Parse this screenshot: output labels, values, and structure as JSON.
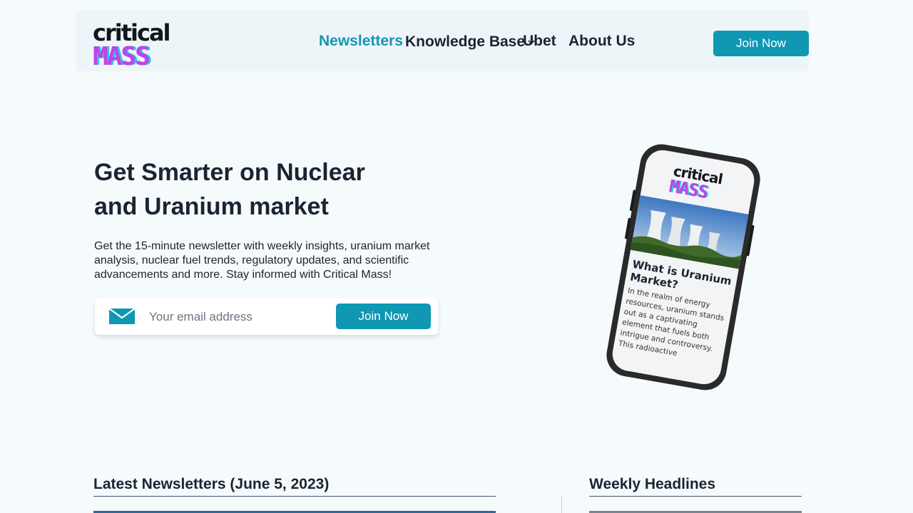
{
  "header": {
    "logo": {
      "top": "critical",
      "bottom": "MASS"
    },
    "nav": [
      {
        "label": "Newsletters",
        "active": true
      },
      {
        "label": "Knowledge Base",
        "has_dropdown": true
      },
      {
        "label": "Ubet"
      },
      {
        "label": "About Us"
      }
    ],
    "cta_label": "Join Now"
  },
  "hero": {
    "title_line1": "Get Smarter on Nuclear",
    "title_line2": "and Uranium market",
    "description": "Get the 15-minute newsletter with weekly insights, uranium market analysis, nuclear fuel trends, regulatory updates, and scientific advancements and more. Stay informed with Critical Mass!",
    "email_placeholder": "Your email address",
    "submit_label": "Join Now"
  },
  "phone_preview": {
    "logo_top": "critical",
    "logo_bottom": "MASS",
    "article_title": "What is Uranium Market?",
    "article_body": "In the realm of energy resources, uranium stands out as a captivating element that fuels both intrigue and controversy. This radioactive"
  },
  "sections": {
    "latest_title": "Latest Newsletters (June 5, 2023)",
    "weekly_title": "Weekly Headlines"
  },
  "colors": {
    "accent": "#0f97b4",
    "nav_active": "#1596b0",
    "text": "#1b2431",
    "background": "#f5fafd",
    "logo_magenta": "#c440e8",
    "logo_cyan": "#25c6e9"
  },
  "icons": {
    "email": "envelope-icon",
    "dropdown": "chevron-down-icon"
  }
}
